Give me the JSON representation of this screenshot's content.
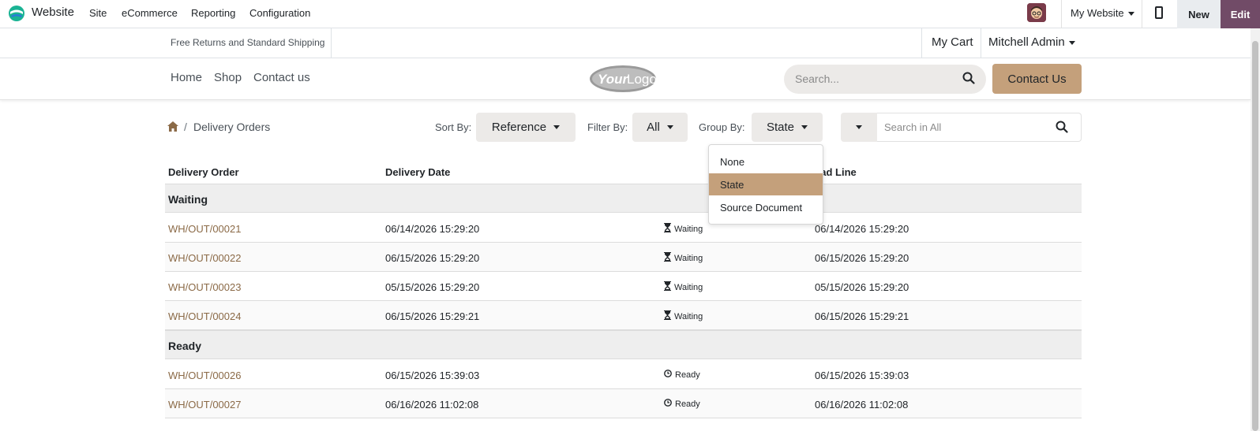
{
  "admin": {
    "app_name": "Website",
    "menu": [
      "Site",
      "eCommerce",
      "Reporting",
      "Configuration"
    ],
    "website_selector": "My Website",
    "new_label": "New",
    "edit_label": "Edit",
    "accent_color": "#714b67"
  },
  "header": {
    "promo": "Free Returns and Standard Shipping",
    "cart": "My Cart",
    "user": "Mitchell Admin",
    "nav": [
      "Home",
      "Shop",
      "Contact us"
    ],
    "search_placeholder": "Search...",
    "contact_button": "Contact Us",
    "brand_color": "#c4a07b"
  },
  "controls": {
    "breadcrumb": "Delivery Orders",
    "sort_label": "Sort By:",
    "sort_value": "Reference",
    "filter_label": "Filter By:",
    "filter_value": "All",
    "group_label": "Group By:",
    "group_value": "State",
    "search_placeholder": "Search in All"
  },
  "table": {
    "columns": [
      "Delivery Order",
      "Delivery Date",
      "ead Line"
    ],
    "groups": [
      {
        "name": "Waiting",
        "rows": [
          {
            "ref": "WH/OUT/00021",
            "date": "06/14/2026 15:29:20",
            "state": "Waiting",
            "deadline": "06/14/2026 15:29:20"
          },
          {
            "ref": "WH/OUT/00022",
            "date": "06/15/2026 15:29:20",
            "state": "Waiting",
            "deadline": "06/15/2026 15:29:20"
          },
          {
            "ref": "WH/OUT/00023",
            "date": "05/15/2026 15:29:20",
            "state": "Waiting",
            "deadline": "05/15/2026 15:29:20"
          },
          {
            "ref": "WH/OUT/00024",
            "date": "06/15/2026 15:29:21",
            "state": "Waiting",
            "deadline": "06/15/2026 15:29:21"
          }
        ]
      },
      {
        "name": "Ready",
        "rows": [
          {
            "ref": "WH/OUT/00026",
            "date": "06/15/2026 15:39:03",
            "state": "Ready",
            "deadline": "06/15/2026 15:39:03"
          },
          {
            "ref": "WH/OUT/00027",
            "date": "06/16/2026 11:02:08",
            "state": "Ready",
            "deadline": "06/16/2026 11:02:08"
          }
        ]
      }
    ]
  },
  "group_menu": {
    "options": [
      "None",
      "State",
      "Source Document"
    ],
    "selected": "State"
  }
}
